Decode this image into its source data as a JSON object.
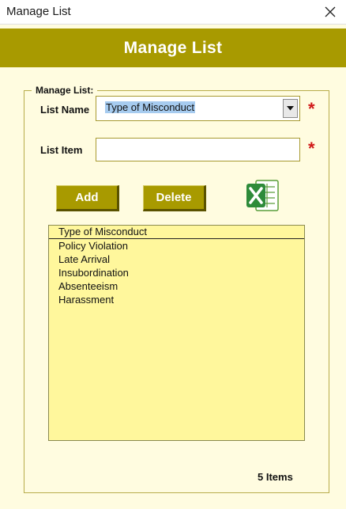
{
  "window": {
    "title": "Manage List"
  },
  "header": {
    "title": "Manage List"
  },
  "form": {
    "group_label": "Manage List:",
    "list_name_label": "List Name",
    "list_name_value": "Type of Misconduct",
    "list_item_label": "List Item",
    "list_item_value": "",
    "required_mark": "*",
    "add_label": "Add",
    "delete_label": "Delete"
  },
  "list": {
    "header": "Type of Misconduct",
    "items": [
      "Policy Violation",
      "Late Arrival",
      "Insubordination",
      "Absenteeism",
      "Harassment"
    ]
  },
  "count_text": "5 Items",
  "icons": {
    "close": "close-icon",
    "dropdown": "chevron-down-icon",
    "export": "excel-icon"
  },
  "colors": {
    "brand": "#A89A00",
    "background": "#FFFCE0",
    "list_background": "#FFF79C",
    "required": "#D01818"
  }
}
